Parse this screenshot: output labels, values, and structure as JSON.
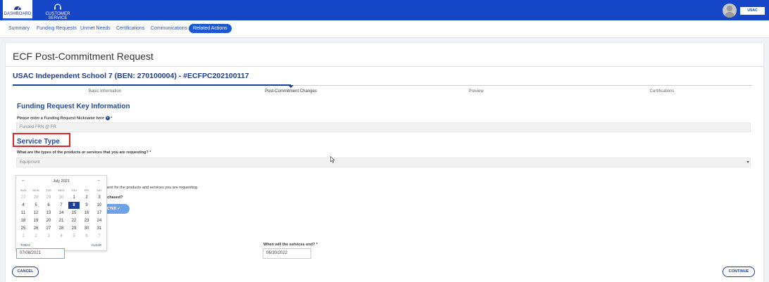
{
  "topnav": {
    "dashboard_label": "DASHBOARD",
    "customer_service_label": "CUSTOMER SERVICE",
    "logo_text": "USAC"
  },
  "subnav": {
    "summary": "Summary",
    "funding_requests": "Funding Requests",
    "unmet_needs": "Unmet Needs",
    "certifications": "Certifications",
    "communications": "Communications",
    "related_actions": "Related Actions"
  },
  "page": {
    "title": "ECF Post-Commitment Request",
    "entity": "USAC Independent School 7 (BEN: 270100004) - #ECFPC202100117",
    "steps": [
      "Basic Information",
      "Post-Commitment Changes",
      "Preview",
      "Certifications"
    ],
    "current_step": "Post-Commitment Changes"
  },
  "form": {
    "frn_heading": "Funding Request Key Information",
    "nickname_label": "Please enter a Funding Request Nickname here",
    "nickname_value": "Funded FRN @ FR",
    "service_type_heading": "Service Type",
    "service_question": "What are the types of the products or services that you are requesting?",
    "service_value": "Equipment",
    "partial_text_1": "nent for the products and services you are requesting.",
    "partial_text_2": "rchased?",
    "contracted_label": "ACTED",
    "services_end_label": "When will the services end?",
    "start_date_value": "07/08/2021",
    "end_date_value": "06/30/2022",
    "required_mark": "*"
  },
  "calendar": {
    "month_label": "July 2021",
    "dow": [
      "SUN",
      "MON",
      "TUE",
      "WED",
      "THU",
      "FRI",
      "SAT"
    ],
    "weeks": [
      [
        "27",
        "28",
        "29",
        "30",
        "1",
        "2",
        "3"
      ],
      [
        "4",
        "5",
        "6",
        "7",
        "8",
        "9",
        "10"
      ],
      [
        "11",
        "12",
        "13",
        "14",
        "15",
        "16",
        "17"
      ],
      [
        "18",
        "19",
        "20",
        "21",
        "22",
        "23",
        "24"
      ],
      [
        "25",
        "26",
        "27",
        "28",
        "29",
        "30",
        "31"
      ],
      [
        "1",
        "2",
        "3",
        "4",
        "5",
        "6",
        "7"
      ]
    ],
    "selected": "8",
    "today_label": "TODAY",
    "clear_label": "CLEAR"
  },
  "buttons": {
    "cancel": "CANCEL",
    "continue": "CONTINUE"
  },
  "colors": {
    "brand_blue": "#1646c8",
    "heading_blue": "#1f4b9c",
    "highlight_red": "#d8262e"
  }
}
